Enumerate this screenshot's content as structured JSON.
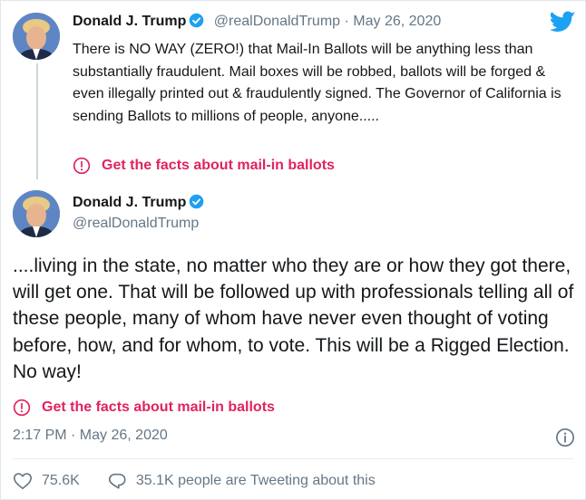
{
  "tweet1": {
    "name": "Donald J. Trump",
    "handle": "@realDonaldTrump",
    "separator": "·",
    "date": "May 26, 2020",
    "text": "There is NO WAY (ZERO!) that Mail-In Ballots will be anything less than substantially fraudulent. Mail boxes will be robbed, ballots will be forged & even illegally printed out & fraudulently signed. The Governor of California is sending Ballots to millions of people, anyone.....",
    "facts_label": "Get the facts about mail-in ballots"
  },
  "tweet2": {
    "name": "Donald J. Trump",
    "handle": "@realDonaldTrump",
    "text": "....living in the state, no matter who they are or how they got there, will get one. That will be followed up with professionals telling all of these people, many of whom have never even thought of voting before, how, and for whom, to vote. This will be a Rigged Election. No way!",
    "facts_label": "Get the facts about mail-in ballots",
    "timestamp": "2:17 PM · May 26, 2020",
    "likes": "75.6K",
    "tweeting": "35.1K people are Tweeting about this"
  },
  "colors": {
    "blue": "#1da1f2",
    "pink": "#e0245e",
    "gray": "#657786"
  },
  "icons": [
    "twitter-bird-icon",
    "verified-badge-icon",
    "alert-icon",
    "info-icon",
    "heart-icon",
    "comment-bubble-icon"
  ]
}
